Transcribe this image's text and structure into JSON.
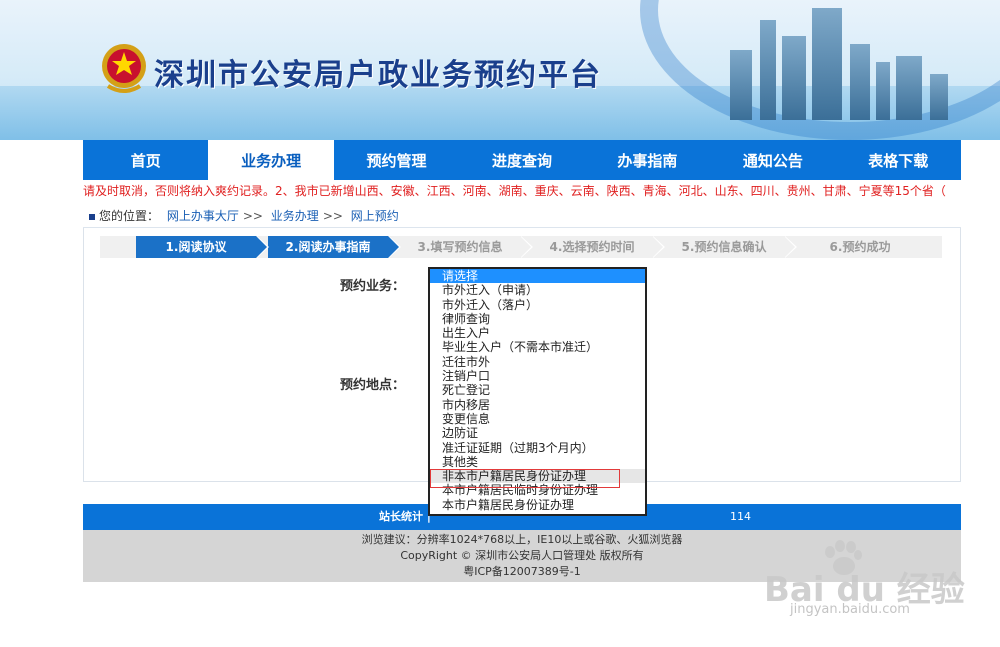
{
  "header": {
    "title": "深圳市公安局户政业务预约平台",
    "emblem": "police-emblem-icon"
  },
  "nav": {
    "items": [
      "首页",
      "业务办理",
      "预约管理",
      "进度查询",
      "办事指南",
      "通知公告",
      "表格下载"
    ],
    "active_index": 1
  },
  "notice": "请及时取消，否则将纳入爽约记录。2、我市已新增山西、安徽、江西、河南、湖南、重庆、云南、陕西、青海、河北、山东、四川、贵州、甘肃、宁夏等15个省（",
  "breadcrumb": {
    "prefix": "您的位置：",
    "items": [
      "网上办事大厅",
      "业务办理",
      "网上预约"
    ],
    "separator": ">>"
  },
  "steps": [
    "1.阅读协议",
    "2.阅读办事指南",
    "3.填写预约信息",
    "4.选择预约时间",
    "5.预约信息确认",
    "6.预约成功"
  ],
  "steps_done": 2,
  "form": {
    "business_label": "预约业务：",
    "location_label": "预约地点："
  },
  "dropdown": {
    "options": [
      "请选择",
      "市外迁入（申请）",
      "市外迁入（落户）",
      "律师查询",
      "出生入户",
      "毕业生入户（不需本市准迁）",
      "迁往市外",
      "注销户口",
      "死亡登记",
      "市内移居",
      "变更信息",
      "边防证",
      "准迁证延期（过期3个月内）",
      "其他类",
      "非本市户籍居民身份证办理",
      "本市户籍居民临时身份证办理",
      "本市户籍居民身份证办理"
    ],
    "selected_index": 0,
    "hover_index": 14
  },
  "footer": {
    "stats_label": "站长统计 |",
    "phone_tail": "114",
    "lines": [
      "浏览建议：分辨率1024*768以上，IE10以上或谷歌、火狐浏览器",
      "CopyRight © 深圳市公安局人口管理处 版权所有",
      "粤ICP备12007389号-1"
    ]
  },
  "watermark": {
    "brand": "Bai du 经验",
    "url": "jingyan.baidu.com"
  },
  "colors": {
    "nav_blue": "#0a73d8",
    "notice_red": "#e02020",
    "step_blue": "#1b71c7",
    "select_blue": "#1e90ff",
    "highlight_red": "#e23a3a"
  }
}
